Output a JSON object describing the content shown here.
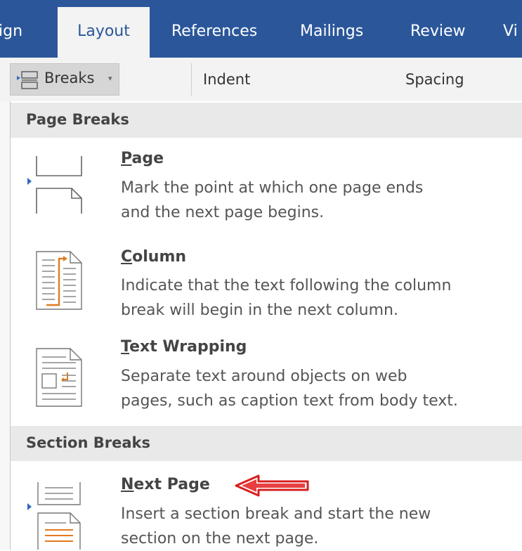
{
  "ribbon": {
    "tabs": [
      {
        "label": "ign",
        "active": false
      },
      {
        "label": "Layout",
        "active": true
      },
      {
        "label": "References",
        "active": false
      },
      {
        "label": "Mailings",
        "active": false
      },
      {
        "label": "Review",
        "active": false
      },
      {
        "label": "Vi",
        "active": false
      }
    ]
  },
  "toolbar": {
    "breaks_label": "Breaks",
    "breaks_arrow": "▾",
    "indent_label": "Indent",
    "spacing_label": "Spacing"
  },
  "menu": {
    "sections": [
      {
        "header": "Page Breaks",
        "items": [
          {
            "title_mnemonic": "P",
            "title_rest": "age",
            "desc_line1": "Mark the point at which one page ends",
            "desc_line2": "and the next page begins.",
            "icon": "page-break-icon"
          },
          {
            "title_mnemonic": "C",
            "title_rest": "olumn",
            "desc_line1": "Indicate that the text following the column",
            "desc_line2": "break will begin in the next column.",
            "icon": "column-break-icon"
          },
          {
            "title_mnemonic": "T",
            "title_rest": "ext Wrapping",
            "desc_line1": "Separate text around objects on web",
            "desc_line2": "pages, such as caption text from body text.",
            "icon": "text-wrapping-break-icon"
          }
        ]
      },
      {
        "header": "Section Breaks",
        "items": [
          {
            "title_mnemonic": "N",
            "title_rest": "ext Page",
            "desc_line1": "Insert a section break and start the new",
            "desc_line2": "section on the next page.",
            "icon": "next-page-section-break-icon"
          }
        ]
      }
    ]
  },
  "colors": {
    "ribbon_blue": "#2b579a",
    "annotation_red": "#d62020",
    "icon_orange": "#e07b20"
  }
}
